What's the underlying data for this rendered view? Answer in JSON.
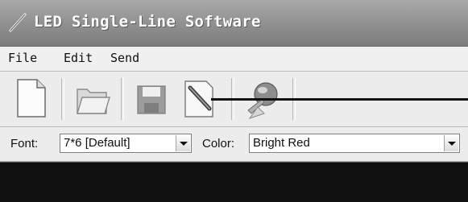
{
  "window": {
    "title": "LED Single-Line Software",
    "app_icon": "pen-icon"
  },
  "menu": {
    "items": [
      "File",
      "Edit",
      "Send"
    ]
  },
  "toolbar": {
    "buttons": [
      {
        "name": "new",
        "icon": "new-document-icon"
      },
      {
        "name": "open",
        "icon": "open-folder-icon"
      },
      {
        "name": "save",
        "icon": "save-disk-icon"
      },
      {
        "name": "edit",
        "icon": "pen-edit-icon"
      },
      {
        "name": "send",
        "icon": "globe-send-icon"
      }
    ]
  },
  "options": {
    "font_label": "Font:",
    "font_value": "7*6 [Default]",
    "color_label": "Color:",
    "color_value": "Bright Red"
  },
  "colors": {
    "titlebar": "#8f8f8f",
    "display_background": "#101010"
  }
}
